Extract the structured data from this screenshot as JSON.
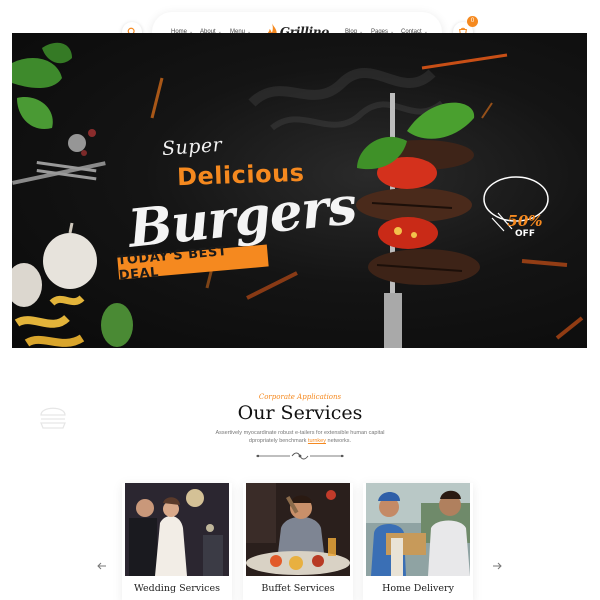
{
  "nav": {
    "left_items": [
      {
        "label": "Home",
        "caret": "⌄"
      },
      {
        "label": "About",
        "caret": "⌄"
      },
      {
        "label": "Menu",
        "caret": "⌄"
      }
    ],
    "right_items": [
      {
        "label": "Blog",
        "caret": "⌄"
      },
      {
        "label": "Pages",
        "caret": "⌄"
      },
      {
        "label": "Contact",
        "caret": "⌄"
      }
    ],
    "logo_text": "Grillino",
    "cart_count": "0",
    "icons": {
      "search": "search-icon",
      "cart": "cart-icon",
      "logo": "flame-icon"
    }
  },
  "hero": {
    "super": "Super",
    "headline": "Delicious",
    "script": "Burgers",
    "deal": "TODAY'S BEST DEAL",
    "discount": "50%",
    "discount_label": "OFF"
  },
  "services": {
    "kicker": "Corporate Applications",
    "title": "Our Services",
    "desc_line1": "Assertively myocardinate robust e-tailers for extensible human capital",
    "desc_line2_pre": "dpropriately benchmark ",
    "desc_highlight": "turnkey",
    "desc_line2_post": " networks.",
    "cards": [
      {
        "title": "Wedding Services"
      },
      {
        "title": "Buffet Services"
      },
      {
        "title": "Home Delivery"
      }
    ],
    "icons": {
      "prev": "arrow-left-icon",
      "next": "arrow-right-icon"
    }
  },
  "colors": {
    "accent": "#f5891f",
    "dark": "#111111",
    "text_muted": "#777777"
  }
}
